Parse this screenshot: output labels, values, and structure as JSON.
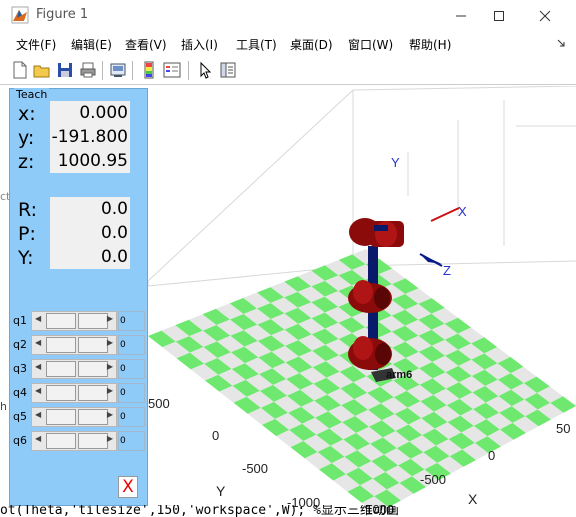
{
  "window": {
    "title": "Figure 1"
  },
  "menubar": [
    "文件(F)",
    "编辑(E)",
    "查看(V)",
    "插入(I)",
    "工具(T)",
    "桌面(D)",
    "窗口(W)",
    "帮助(H)"
  ],
  "panel": {
    "title": "Teach",
    "coords": [
      {
        "label": "x:",
        "value": "0.000"
      },
      {
        "label": "y:",
        "value": "-191.800"
      },
      {
        "label": "z:",
        "value": "1000.95"
      }
    ],
    "rpy": [
      {
        "label": "R:",
        "value": "0.0"
      },
      {
        "label": "P:",
        "value": "0.0"
      },
      {
        "label": "Y:",
        "value": "0.0"
      }
    ],
    "joints": [
      {
        "label": "q1",
        "value": "0"
      },
      {
        "label": "q2",
        "value": "0"
      },
      {
        "label": "q3",
        "value": "0"
      },
      {
        "label": "q4",
        "value": "0"
      },
      {
        "label": "q5",
        "value": "0"
      },
      {
        "label": "q6",
        "value": "0"
      }
    ],
    "close_label": "X"
  },
  "plot": {
    "axis_y_name": "Y",
    "axis_x_name": "X",
    "y_ticks": [
      "500",
      "0",
      "-500",
      "-1000"
    ],
    "x_ticks": [
      "-1000",
      "-500",
      "0",
      "50"
    ],
    "frame_labels": {
      "x": "X",
      "y": "Y",
      "z": "Z"
    },
    "robot_name": "arm6"
  },
  "background_code": "ot(Theta,'tilesize',150,'workspace',W); %显示三维动画",
  "colors": {
    "panel_bg": "#8fcbf8",
    "tile_green": "#6ee86e",
    "tile_gray": "#e6e6e6",
    "link_red": "#8b0a0a",
    "link_blue": "#0a1a6b"
  }
}
